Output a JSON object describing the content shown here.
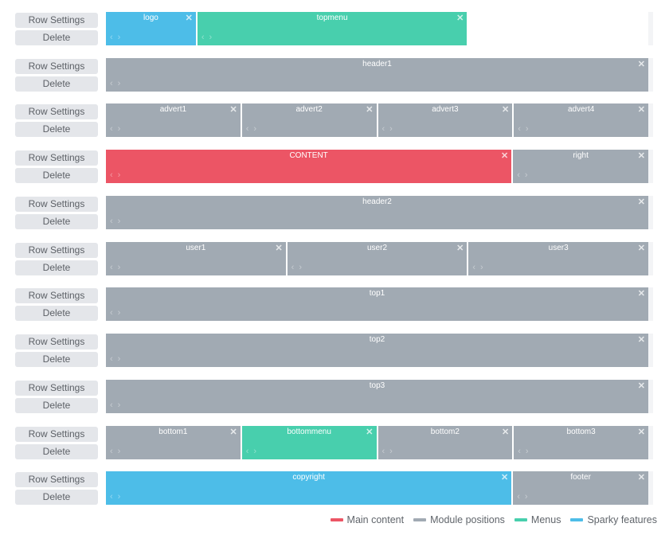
{
  "buttons": {
    "row_settings": "Row Settings",
    "delete": "Delete"
  },
  "icons": {
    "close": "✕",
    "prev": "‹",
    "next": "›"
  },
  "colors": {
    "main": "#ec5565",
    "module": "#a1aab3",
    "menu": "#48cfad",
    "sparky": "#4dbde8"
  },
  "rows": [
    {
      "blocks": [
        {
          "name": "logo",
          "type": "blue",
          "span": 2
        },
        {
          "name": "topmenu",
          "type": "green",
          "span": 6
        }
      ]
    },
    {
      "blocks": [
        {
          "name": "header1",
          "type": "grey",
          "span": 12
        }
      ]
    },
    {
      "blocks": [
        {
          "name": "advert1",
          "type": "grey",
          "span": 3
        },
        {
          "name": "advert2",
          "type": "grey",
          "span": 3
        },
        {
          "name": "advert3",
          "type": "grey",
          "span": 3
        },
        {
          "name": "advert4",
          "type": "grey",
          "span": 3
        }
      ]
    },
    {
      "blocks": [
        {
          "name": "CONTENT",
          "type": "red",
          "span": 9
        },
        {
          "name": "right",
          "type": "grey",
          "span": 3
        }
      ]
    },
    {
      "blocks": [
        {
          "name": "header2",
          "type": "grey",
          "span": 12
        }
      ]
    },
    {
      "blocks": [
        {
          "name": "user1",
          "type": "grey",
          "span": 4
        },
        {
          "name": "user2",
          "type": "grey",
          "span": 4
        },
        {
          "name": "user3",
          "type": "grey",
          "span": 4
        }
      ]
    },
    {
      "blocks": [
        {
          "name": "top1",
          "type": "grey",
          "span": 12
        }
      ]
    },
    {
      "blocks": [
        {
          "name": "top2",
          "type": "grey",
          "span": 12
        }
      ]
    },
    {
      "blocks": [
        {
          "name": "top3",
          "type": "grey",
          "span": 12
        }
      ]
    },
    {
      "blocks": [
        {
          "name": "bottom1",
          "type": "grey",
          "span": 3
        },
        {
          "name": "bottommenu",
          "type": "green",
          "span": 3
        },
        {
          "name": "bottom2",
          "type": "grey",
          "span": 3
        },
        {
          "name": "bottom3",
          "type": "grey",
          "span": 3
        }
      ]
    },
    {
      "blocks": [
        {
          "name": "copyright",
          "type": "blue",
          "span": 9
        },
        {
          "name": "footer",
          "type": "grey",
          "span": 3
        }
      ]
    }
  ],
  "legend": [
    {
      "label": "Main content",
      "color": "#ec5565"
    },
    {
      "label": "Module positions",
      "color": "#a1aab3"
    },
    {
      "label": "Menus",
      "color": "#48cfad"
    },
    {
      "label": "Sparky features",
      "color": "#4dbde8"
    }
  ]
}
